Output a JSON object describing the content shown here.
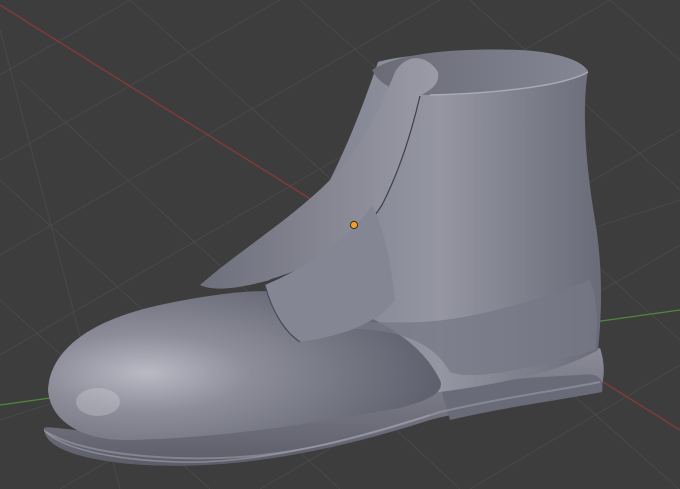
{
  "viewport": {
    "type": "3d-viewport",
    "background_color": "#3d3d3d",
    "grid_color": "#4a4a4a",
    "x_axis_color": "#8b3a3a",
    "y_axis_color": "#4f8a3a"
  },
  "scene": {
    "object": "boot-mesh",
    "shading": "solid",
    "material_color": "#8a8b98",
    "has_origin_marker": true,
    "origin_marker_color": "#f0a030"
  }
}
